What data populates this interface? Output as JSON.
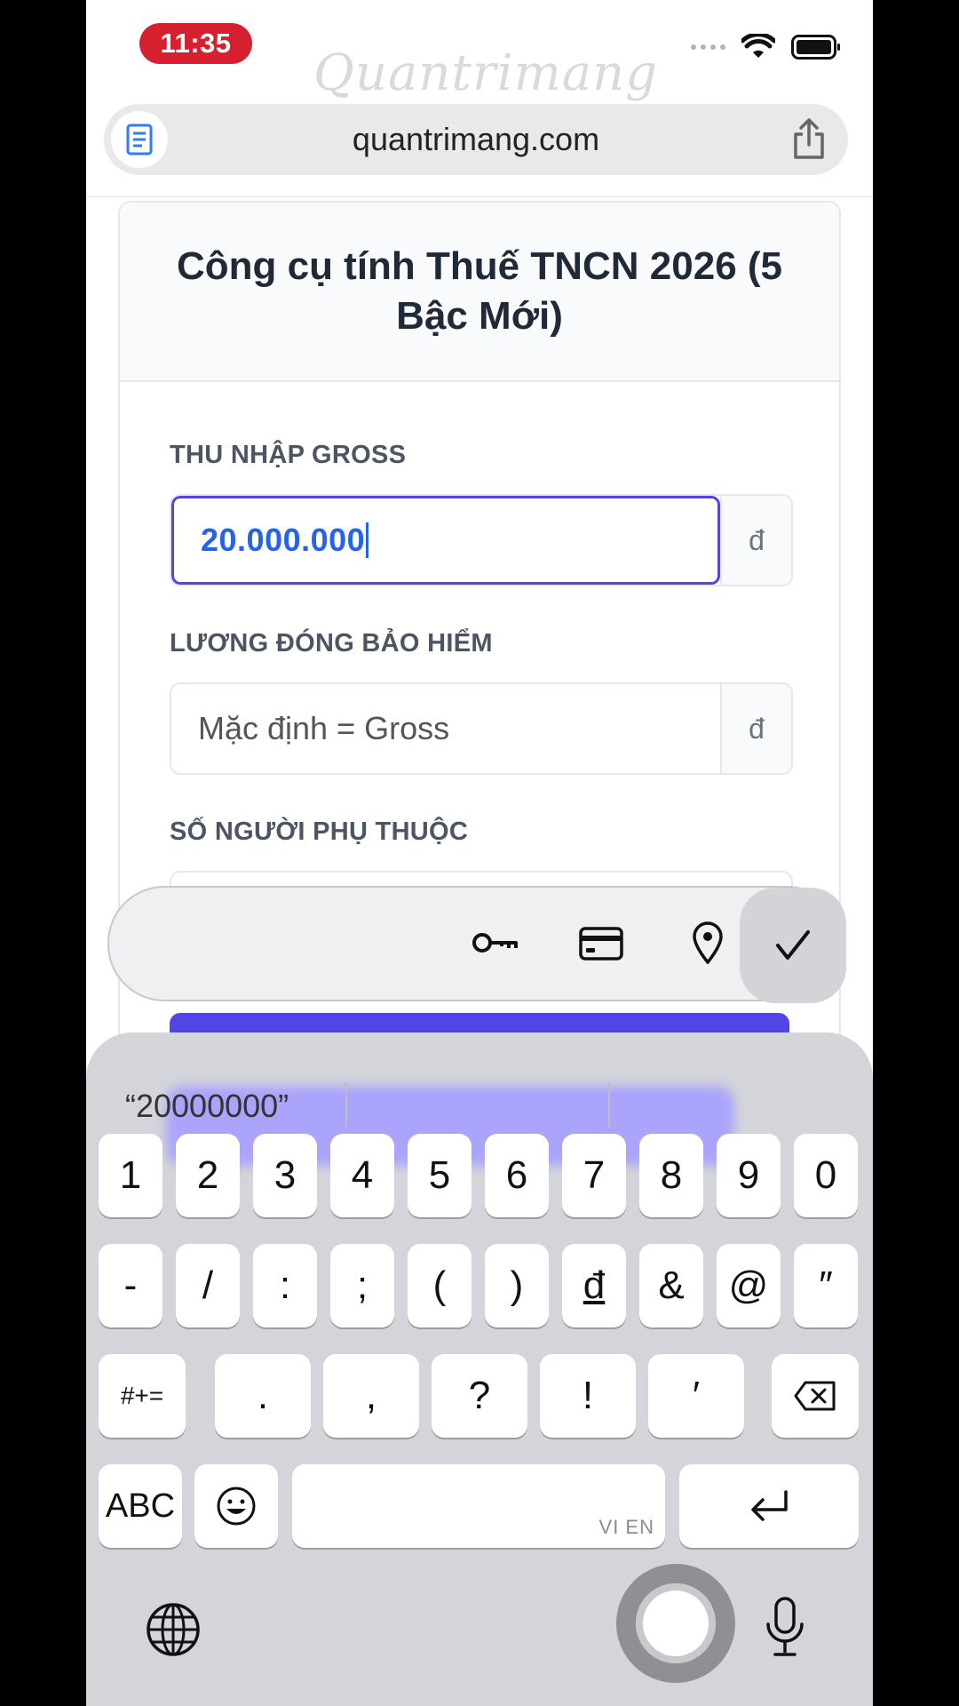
{
  "status": {
    "time": "11:35"
  },
  "watermark": "Quantrimang",
  "browser": {
    "url": "quantrimang.com"
  },
  "page": {
    "title": "Công cụ tính Thuế TNCN 2026 (5 Bậc Mới)",
    "gross_label": "THU NHẬP GROSS",
    "gross_value": "20.000.000",
    "currency": "đ",
    "insurance_label": "LƯƠNG ĐÓNG BẢO HIỂM",
    "insurance_placeholder": "Mặc định = Gross",
    "dependents_label": "SỐ NGƯỜI PHỤ THUỘC"
  },
  "autofill": {
    "icons": [
      "key-icon",
      "credit-card-icon",
      "location-pin-icon"
    ],
    "done": "checkmark-icon"
  },
  "keyboard": {
    "suggestion": "“20000000”",
    "row1": [
      "1",
      "2",
      "3",
      "4",
      "5",
      "6",
      "7",
      "8",
      "9",
      "0"
    ],
    "row2": [
      "-",
      "/",
      ":",
      ";",
      "(",
      ")",
      "đ",
      "&",
      "@",
      "″"
    ],
    "row3_left": "#+=",
    "row3": [
      ".",
      ",",
      "?",
      "!",
      "′"
    ],
    "abc": "ABC",
    "lang": "VI EN"
  },
  "colors": {
    "accent": "#4f46e5",
    "time_pill": "#d6202f",
    "value_text": "#2563eb"
  }
}
